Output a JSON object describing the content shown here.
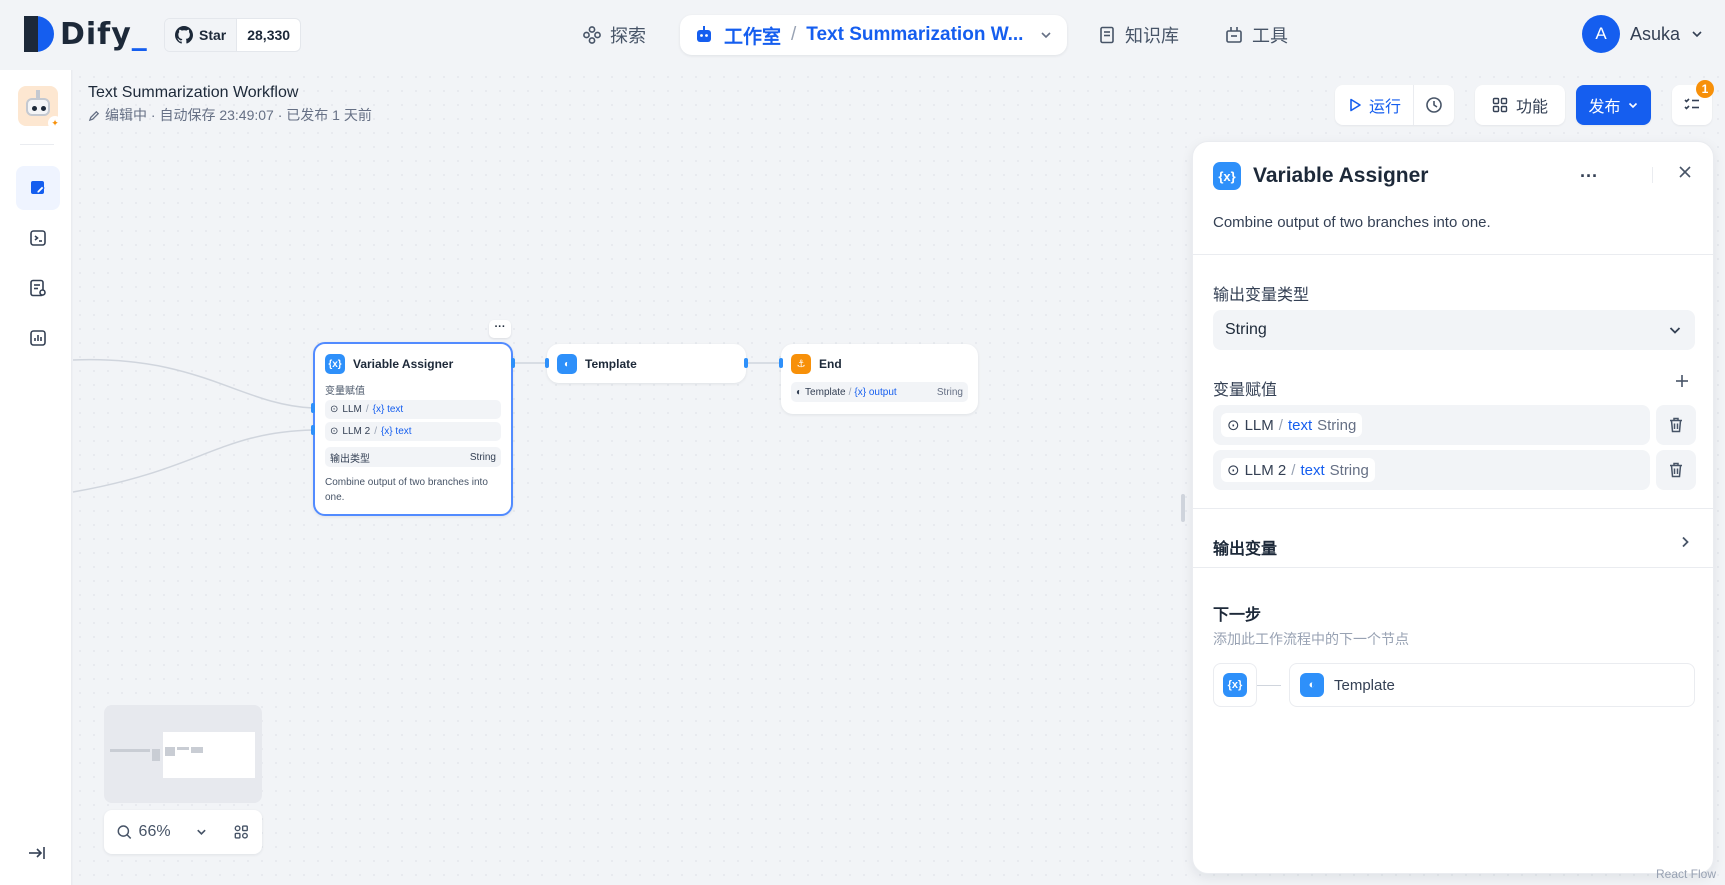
{
  "brand": {
    "logo_text": "Dify",
    "logo_cursor": "_"
  },
  "github": {
    "star_label": "Star",
    "star_count": "28,330"
  },
  "nav": {
    "explore": "探索",
    "studio": "工作室",
    "current_app": "Text Summarization W...",
    "knowledge": "知识库",
    "tools": "工具"
  },
  "user": {
    "initial": "A",
    "name": "Asuka"
  },
  "workflow": {
    "title": "Text Summarization Workflow",
    "status": "编辑中 · 自动保存 23:49:07 · 已发布 1 天前"
  },
  "toolbar": {
    "run_label": "运行",
    "features_label": "功能",
    "publish_label": "发布",
    "checklist_badge": "1"
  },
  "nodes": {
    "variable_assigner": {
      "title": "Variable Assigner",
      "vars_label": "变量赋值",
      "vars": [
        {
          "source": "LLM",
          "var": "{x} text"
        },
        {
          "source": "LLM 2",
          "var": "{x} text"
        }
      ],
      "output_type_label": "输出类型",
      "output_type": "String",
      "description": "Combine output of two branches into one."
    },
    "template": {
      "title": "Template"
    },
    "end": {
      "title": "End",
      "output_source": "Template",
      "output_var": "{x} output",
      "output_type": "String"
    }
  },
  "zoom": {
    "level": "66%"
  },
  "panel": {
    "title": "Variable Assigner",
    "description": "Combine output of two branches into one.",
    "output_type_label": "输出变量类型",
    "output_type_value": "String",
    "assign_label": "变量赋值",
    "vars": [
      {
        "source": "LLM",
        "var": "text",
        "type": "String"
      },
      {
        "source": "LLM 2",
        "var": "text",
        "type": "String"
      }
    ],
    "output_vars_label": "输出变量",
    "next_step_label": "下一步",
    "next_step_desc": "添加此工作流程中的下一个节点",
    "next_node": "Template"
  },
  "watermark": "React Flow",
  "colors": {
    "accent": "#155eef",
    "node_blue": "#2e90fa",
    "node_orange": "#f79009"
  }
}
